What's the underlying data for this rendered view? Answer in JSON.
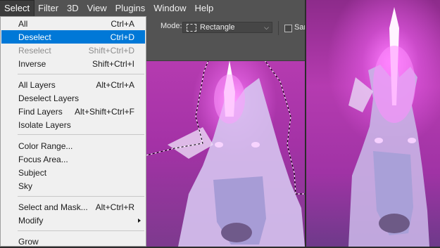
{
  "menubar": {
    "items": [
      "Select",
      "Filter",
      "3D",
      "View",
      "Plugins",
      "Window",
      "Help"
    ],
    "active": "Select"
  },
  "options": {
    "mode_label": "Mode:",
    "mode_value": "Rectangle",
    "checkbox_label_partial": "Sar"
  },
  "menu": {
    "group1": [
      {
        "label": "All",
        "shortcut": "Ctrl+A"
      },
      {
        "label": "Deselect",
        "shortcut": "Ctrl+D"
      },
      {
        "label": "Reselect",
        "shortcut": "Shift+Ctrl+D"
      },
      {
        "label": "Inverse",
        "shortcut": "Shift+Ctrl+I"
      }
    ],
    "group2": [
      {
        "label": "All Layers",
        "shortcut": "Alt+Ctrl+A"
      },
      {
        "label": "Deselect Layers",
        "shortcut": ""
      },
      {
        "label": "Find Layers",
        "shortcut": "Alt+Shift+Ctrl+F"
      },
      {
        "label": "Isolate Layers",
        "shortcut": ""
      }
    ],
    "group3": [
      {
        "label": "Color Range..."
      },
      {
        "label": "Focus Area..."
      },
      {
        "label": "Subject"
      },
      {
        "label": "Sky"
      }
    ],
    "group4": [
      {
        "label": "Select and Mask...",
        "shortcut": "Alt+Ctrl+R"
      },
      {
        "label": "Modify"
      }
    ],
    "group5": [
      {
        "label": "Grow"
      }
    ]
  },
  "colors": {
    "highlight": "#0078d7",
    "menu_bg": "#f0f0f0",
    "chrome": "#535353"
  }
}
